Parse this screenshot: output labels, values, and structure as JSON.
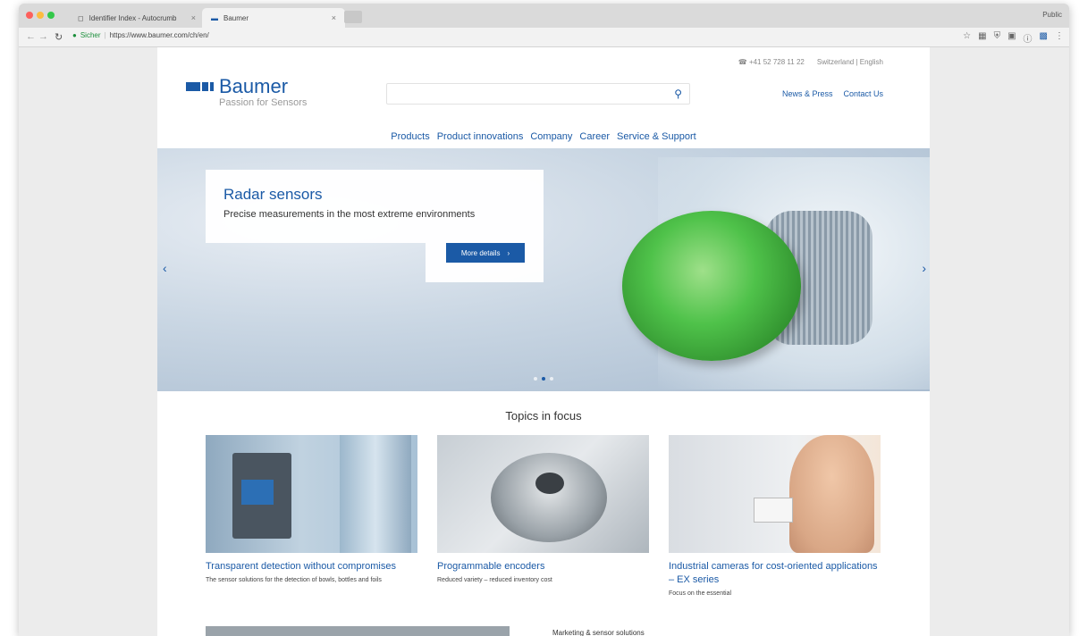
{
  "browser": {
    "tabs": [
      {
        "label": "Identifier Index - Autocrumb",
        "active": false
      },
      {
        "label": "Baumer",
        "active": true
      }
    ],
    "profile": "Public",
    "url_secure_label": "Sicher",
    "url": "https://www.baumer.com/ch/en/"
  },
  "header": {
    "utility": {
      "phone": "+41 52 728 11 22",
      "region": "Switzerland",
      "language": "English"
    },
    "logo": {
      "name": "Baumer",
      "tagline": "Passion for Sensors"
    },
    "search": {
      "placeholder": ""
    },
    "links": [
      "News & Press",
      "Contact Us"
    ],
    "nav": [
      "Products",
      "Product innovations",
      "Company",
      "Career",
      "Service & Support"
    ]
  },
  "hero": {
    "title": "Radar sensors",
    "subtitle": "Precise measurements in the most extreme environments",
    "button_label": "More details",
    "slides_count": 3,
    "active_slide": 2
  },
  "topics": {
    "title": "Topics in focus",
    "cards": [
      {
        "title": "Transparent detection without compromises",
        "text": "The sensor solutions for the detection of bowls, bottles and foils"
      },
      {
        "title": "Programmable encoders",
        "text": "Reduced variety – reduced inventory cost"
      },
      {
        "title": "Industrial cameras for cost-oriented applications – EX series",
        "text": "Focus on the essential"
      }
    ]
  },
  "teaser": {
    "text": "Marketing & sensor solutions"
  },
  "colors": {
    "brand": "#1b5aa6",
    "background": "#ececec"
  }
}
